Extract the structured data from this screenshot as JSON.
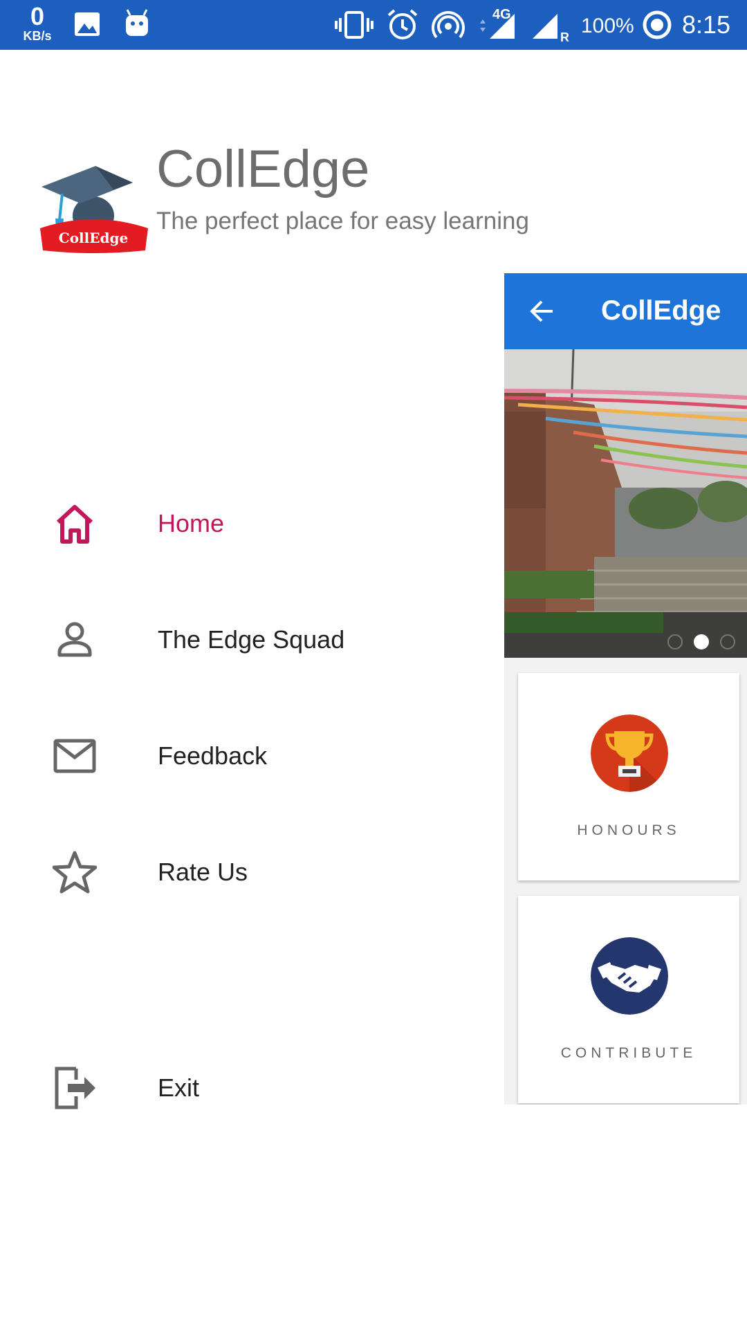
{
  "status_bar": {
    "speed_value": "0",
    "speed_unit": "KB/s",
    "network": "4G",
    "roaming": "R",
    "battery": "100%",
    "time": "8:15"
  },
  "drawer": {
    "title": "CollEdge",
    "subtitle": "The perfect place for easy learning",
    "logo_text": "CollEdge",
    "items": [
      {
        "label": "Home",
        "icon": "home-icon",
        "active": true
      },
      {
        "label": "The Edge Squad",
        "icon": "person-icon",
        "active": false
      },
      {
        "label": "Feedback",
        "icon": "mail-icon",
        "active": false
      },
      {
        "label": "Rate Us",
        "icon": "star-icon",
        "active": false
      },
      {
        "label": "Exit",
        "icon": "exit-icon",
        "active": false
      }
    ]
  },
  "main": {
    "toolbar_title": "CollEdge",
    "cards": [
      {
        "label": "HONOURS",
        "icon": "trophy-icon"
      },
      {
        "label": "CONTRIBUTE",
        "icon": "handshake-icon"
      }
    ]
  },
  "colors": {
    "status_bar": "#1c5fbf",
    "toolbar": "#1e74d9",
    "active_item": "#c2185b",
    "icon_gray": "#666666"
  }
}
